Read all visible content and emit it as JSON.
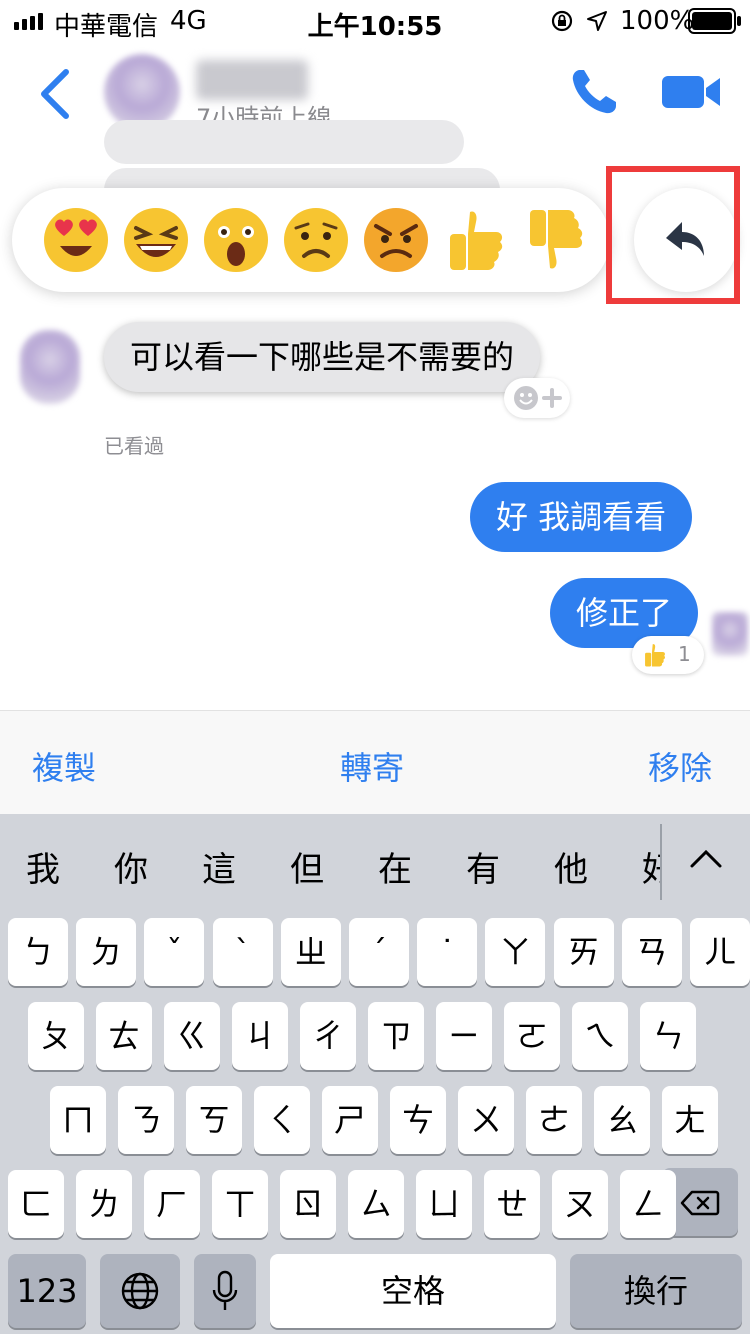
{
  "status_bar": {
    "carrier": "中華電信",
    "network": "4G",
    "time": "上午10:55",
    "battery": "100%"
  },
  "header": {
    "subtitle": "7小時前上線"
  },
  "reactions": [
    "heart-eyes-emoji",
    "laughing-emoji",
    "surprised-emoji",
    "sad-emoji",
    "angry-emoji",
    "thumbs-up-emoji",
    "thumbs-down-emoji"
  ],
  "messages": {
    "incoming": "可以看一下哪些是不需要的",
    "seen": "已看過",
    "outgoing1": "好 我調看看",
    "outgoing2": "修正了",
    "like_count": "1"
  },
  "actions": {
    "copy": "複製",
    "forward": "轉寄",
    "remove": "移除"
  },
  "keyboard": {
    "suggestions": [
      "我",
      "你",
      "這",
      "但",
      "在",
      "有",
      "他",
      "好"
    ],
    "row1": [
      "ㄅ",
      "ㄉ",
      "ˇ",
      "ˋ",
      "ㄓ",
      "ˊ",
      "˙",
      "ㄚ",
      "ㄞ",
      "ㄢ",
      "ㄦ"
    ],
    "row2": [
      "ㄆ",
      "ㄊ",
      "ㄍ",
      "ㄐ",
      "ㄔ",
      "ㄗ",
      "ㄧ",
      "ㄛ",
      "ㄟ",
      "ㄣ"
    ],
    "row3": [
      "ㄇ",
      "ㄋ",
      "ㄎ",
      "ㄑ",
      "ㄕ",
      "ㄘ",
      "ㄨ",
      "ㄜ",
      "ㄠ",
      "ㄤ"
    ],
    "row4": [
      "ㄈ",
      "ㄌ",
      "ㄏ",
      "ㄒ",
      "ㄖ",
      "ㄙ",
      "ㄩ",
      "ㄝ",
      "ㄡ",
      "ㄥ"
    ],
    "num_key": "123",
    "space": "空格",
    "return": "換行"
  },
  "colors": {
    "accent": "#2f7fef",
    "highlight": "#ee3b3b"
  }
}
